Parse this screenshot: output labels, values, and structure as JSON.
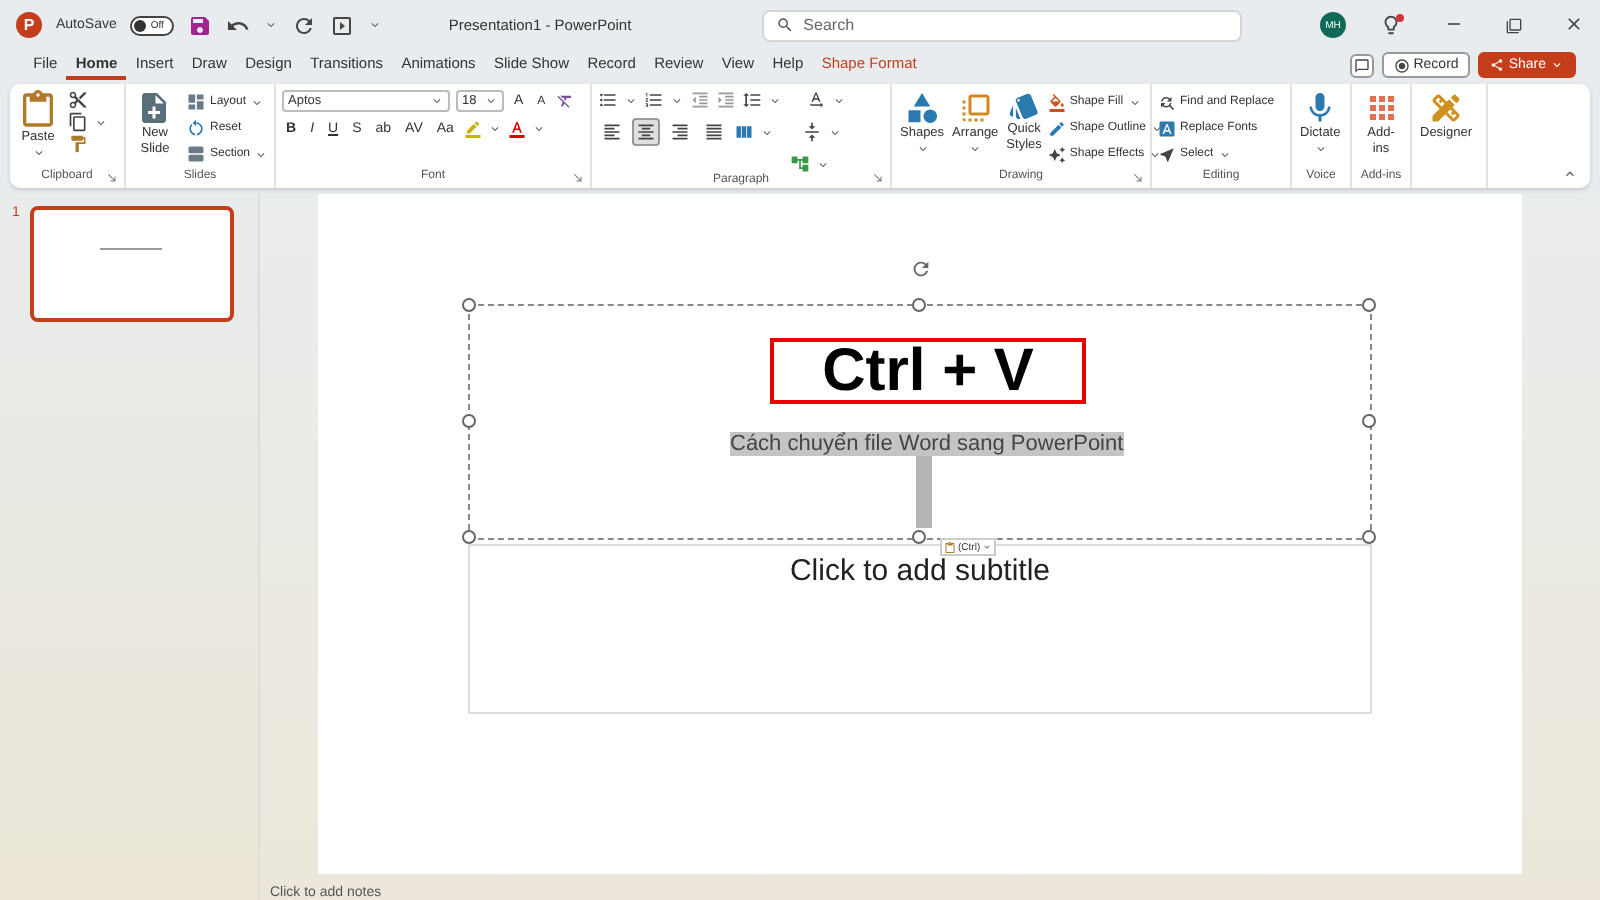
{
  "title_bar": {
    "logo": "P",
    "autosave": {
      "label": "AutoSave",
      "on": false,
      "state_text": "Off"
    },
    "title": "Presentation1 - PowerPoint",
    "search": {
      "placeholder": "Search"
    },
    "avatar": "MH",
    "notification": true
  },
  "tabs": [
    {
      "label": "File",
      "selected": false
    },
    {
      "label": "Home",
      "selected": true
    },
    {
      "label": "Insert",
      "selected": false
    },
    {
      "label": "Draw",
      "selected": false
    },
    {
      "label": "Design",
      "selected": false
    },
    {
      "label": "Transitions",
      "selected": false
    },
    {
      "label": "Animations",
      "selected": false
    },
    {
      "label": "Slide Show",
      "selected": false
    },
    {
      "label": "Record",
      "selected": false
    },
    {
      "label": "Review",
      "selected": false
    },
    {
      "label": "View",
      "selected": false
    },
    {
      "label": "Help",
      "selected": false
    },
    {
      "label": "Shape Format",
      "selected": false,
      "contextual": true
    }
  ],
  "header_buttons": {
    "record": "Record",
    "share": "Share"
  },
  "ribbon": {
    "clipboard": {
      "label": "Clipboard",
      "paste": "Paste",
      "launcher": true
    },
    "slides": {
      "label": "Slides",
      "new_slide": "New Slide",
      "layout": "Layout",
      "reset": "Reset",
      "section": "Section"
    },
    "font": {
      "label": "Font",
      "launcher": true,
      "font_name": "Aptos",
      "font_size": "18",
      "grow": "A",
      "shrink": "A",
      "letters": [
        "B",
        "I",
        "U",
        "S",
        "ab",
        "AV",
        "Aa"
      ]
    },
    "paragraph": {
      "label": "Paragraph",
      "launcher": true,
      "alignments": [
        {
          "selected": false
        },
        {
          "selected": true
        },
        {
          "selected": false
        },
        {
          "selected": false
        }
      ]
    },
    "drawing": {
      "label": "Drawing",
      "launcher": true,
      "shapes": "Shapes",
      "arrange": "Arrange",
      "quick_styles": "Quick Styles",
      "shape_fill": "Shape Fill",
      "shape_outline": "Shape Outline",
      "shape_effects": "Shape Effects"
    },
    "editing": {
      "label": "Editing",
      "find": "Find and Replace",
      "replace_fonts": "Replace Fonts",
      "select": "Select"
    },
    "voice": {
      "label": "Voice",
      "dictate": "Dictate"
    },
    "addins": {
      "label": "Add-ins",
      "addins": "Add-ins"
    },
    "designer": {
      "designer": "Designer"
    }
  },
  "thumbnails": [
    {
      "number": "1",
      "selected": true
    }
  ],
  "slide": {
    "title": "Ctrl + V",
    "pasted_text": "Cách chuyển file Word sang PowerPoint",
    "paste_options": "(Ctrl)",
    "subtitle_placeholder": "Click to add subtitle"
  },
  "notes": {
    "placeholder": "Click to add notes"
  }
}
